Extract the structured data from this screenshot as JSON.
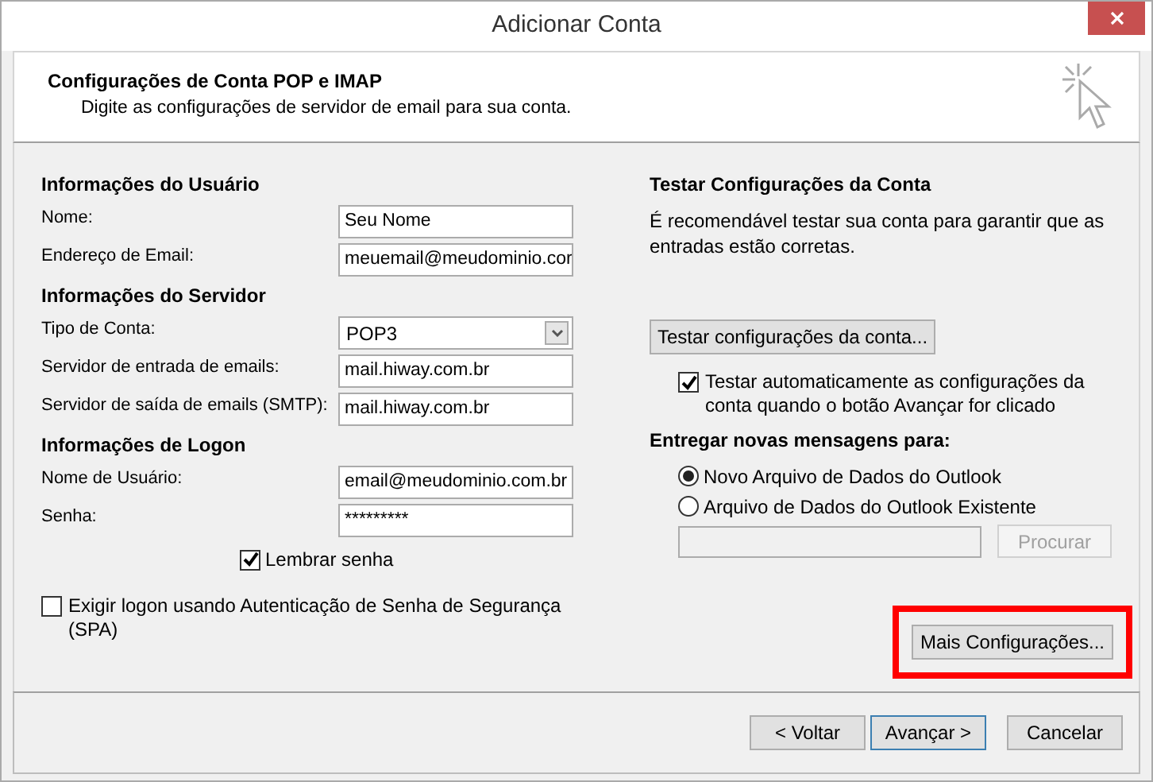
{
  "window": {
    "title": "Adicionar Conta"
  },
  "header": {
    "title": "Configurações de Conta POP e IMAP",
    "subtitle": "Digite as configurações de servidor de email para sua conta."
  },
  "left": {
    "sections": [
      {
        "title": "Informações do Usuário",
        "fields": [
          {
            "kind": "text",
            "label": "Nome:",
            "value": "Seu Nome"
          },
          {
            "kind": "text",
            "label": "Endereço de Email:",
            "value": "meuemail@meudominio.cor"
          }
        ]
      },
      {
        "title": "Informações do Servidor",
        "fields": [
          {
            "kind": "select",
            "label": "Tipo de Conta:",
            "value": "POP3"
          },
          {
            "kind": "text",
            "label": "Servidor de entrada de emails:",
            "value": "mail.hiway.com.br"
          },
          {
            "kind": "text",
            "label": "Servidor de saída de emails (SMTP):",
            "value": "mail.hiway.com.br"
          }
        ]
      },
      {
        "title": "Informações de Logon",
        "fields": [
          {
            "kind": "text",
            "label": "Nome de Usuário:",
            "value": "email@meudominio.com.br"
          },
          {
            "kind": "text",
            "label": "Senha:",
            "value": "*********"
          }
        ]
      }
    ],
    "remember": {
      "label": "Lembrar senha",
      "checked": true
    },
    "spa": {
      "label": "Exigir logon usando Autenticação de Senha de Segurança (SPA)",
      "checked": false
    }
  },
  "right": {
    "title": "Testar Configurações da Conta",
    "description": "É recomendável testar sua conta para garantir que as entradas estão corretas.",
    "test_button": "Testar configurações da conta...",
    "auto_test": {
      "label": "Testar automaticamente as configurações da conta quando o botão Avançar for clicado",
      "checked": true
    },
    "deliver_title": "Entregar novas mensagens para:",
    "options": [
      {
        "label": "Novo Arquivo de Dados do Outlook",
        "selected": true
      },
      {
        "label": "Arquivo de Dados do Outlook Existente",
        "selected": false
      }
    ],
    "browse": {
      "label": "Procurar",
      "disabled": true
    },
    "more_button": {
      "label": "Mais Configurações...",
      "highlighted": true
    }
  },
  "buttons": [
    {
      "label": "< Voltar",
      "default": false
    },
    {
      "label": "Avançar >",
      "default": true
    },
    {
      "label": "Cancelar",
      "default": false
    }
  ]
}
